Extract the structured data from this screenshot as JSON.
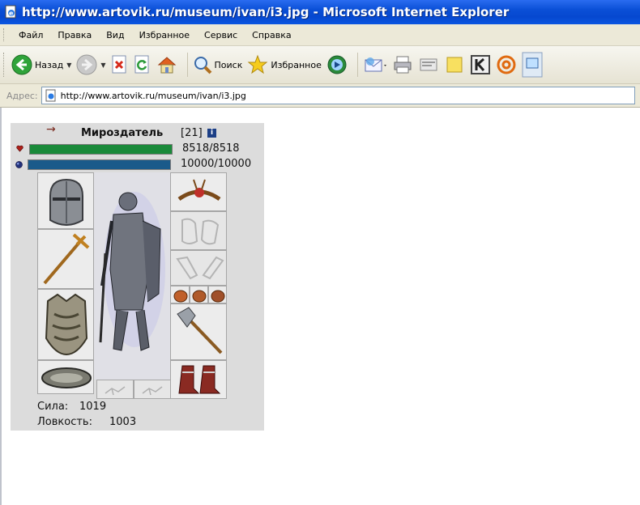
{
  "window": {
    "title": "http://www.artovik.ru/museum/ivan/i3.jpg - Microsoft Internet Explorer"
  },
  "menu": [
    "Файл",
    "Правка",
    "Вид",
    "Избранное",
    "Сервис",
    "Справка"
  ],
  "toolbar": {
    "back_label": "Назад",
    "search_label": "Поиск",
    "favorites_label": "Избранное"
  },
  "address": {
    "label": "Адрес:",
    "url": "http://www.artovik.ru/museum/ivan/i3.jpg"
  },
  "character": {
    "name": "Мироздатель",
    "level": "[21]",
    "info_glyph": "i",
    "hp_text": "8518/8518",
    "hp_fraction": 1.0,
    "mp_text": "10000/10000",
    "mp_fraction": 1.0,
    "strength_label": "Сила:",
    "strength_value": "1019",
    "agility_label": "Ловкость:",
    "agility_value": "1003"
  },
  "colors": {
    "hp": "#1a8a3a",
    "mp": "#1a5a8a",
    "titlebar": "#0a4fd6"
  },
  "icons": [
    "ie-page-icon",
    "back-arrow-icon",
    "forward-arrow-icon",
    "stop-icon",
    "refresh-icon",
    "home-icon",
    "search-icon",
    "favorites-star-icon",
    "media-icon",
    "mail-icon",
    "print-icon",
    "edit-icon",
    "discuss-icon",
    "k-icon",
    "at-icon",
    "go-icon",
    "heart-icon",
    "mana-orb-icon"
  ]
}
